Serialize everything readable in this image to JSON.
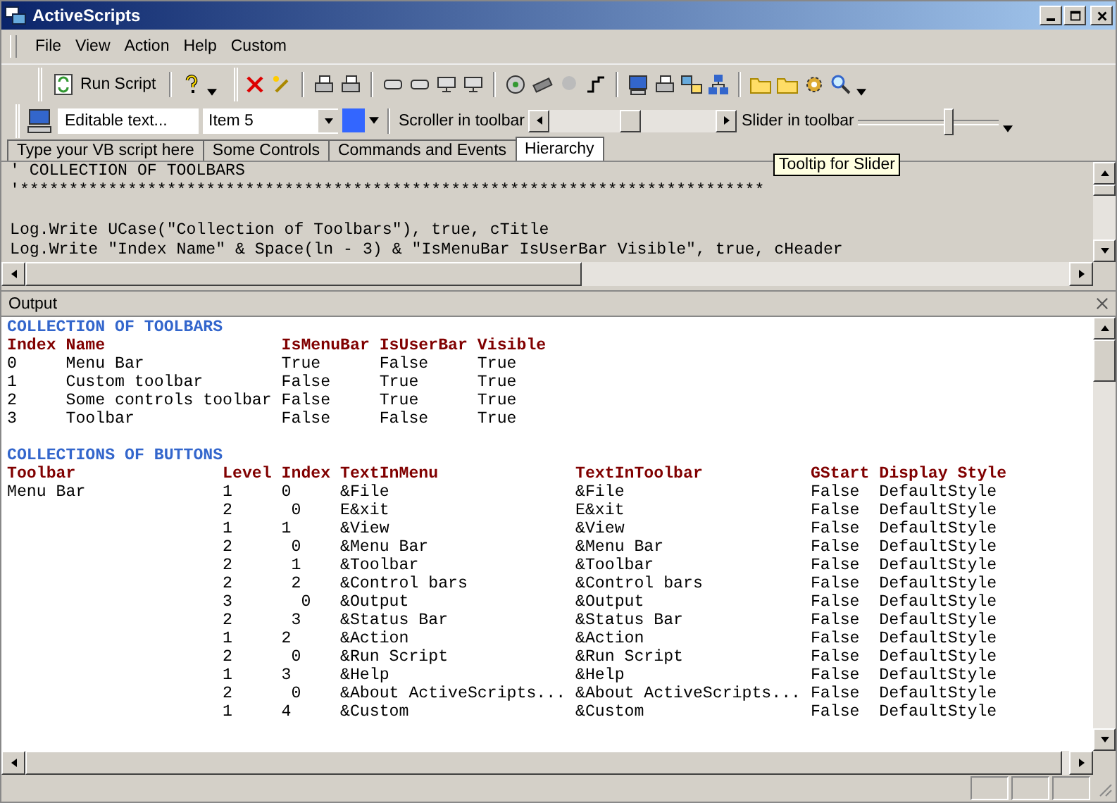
{
  "window": {
    "title": "ActiveScripts"
  },
  "menu": [
    "File",
    "View",
    "Action",
    "Help",
    "Custom"
  ],
  "toolbar": {
    "run_button": "Run Script"
  },
  "controls_bar": {
    "text_field": "Editable text...",
    "combo": "Item 5",
    "color": "#3366ff",
    "scroller_label": "Scroller in toolbar",
    "slider_label": "Slider in toolbar",
    "slider": {
      "level": 0.64
    }
  },
  "tabs": [
    {
      "label": "Type your VB script here",
      "selected": false
    },
    {
      "label": "Some Controls",
      "selected": false
    },
    {
      "label": "Commands and Events",
      "selected": false
    },
    {
      "label": "Hierarchy",
      "selected": true
    }
  ],
  "tooltip": "Tooltip for Slider",
  "script_blocks": [
    [
      "' COLLECTION OF TOOLBARS",
      "'****************************************************************************"
    ],
    [
      "Log.Write UCase(\"Collection of Toolbars\"), true, cTitle",
      "Log.Write \"Index Name\" & Space(ln - 3) & \"IsMenuBar IsUserBar Visible\", true, cHeader"
    ]
  ],
  "output": {
    "title": "Output",
    "sections": [
      {
        "title": "COLLECTION OF TOOLBARS",
        "columns": [
          "Index",
          "Name",
          "IsMenuBar",
          "IsUserBar",
          "Visible"
        ],
        "rows": [
          [
            "0",
            "Menu Bar",
            "True",
            "False",
            "True"
          ],
          [
            "1",
            "Custom toolbar",
            "False",
            "True",
            "True"
          ],
          [
            "2",
            "Some controls toolbar",
            "False",
            "True",
            "True"
          ],
          [
            "3",
            "Toolbar",
            "False",
            "False",
            "True"
          ]
        ]
      },
      {
        "title": "COLLECTIONS OF BUTTONS",
        "columns": [
          "Toolbar",
          "Level",
          "Index",
          "TextInMenu",
          "TextInToolbar",
          "GStart",
          "Display Style"
        ],
        "rows": [
          [
            "Menu Bar",
            "1",
            "0",
            "&File",
            "&File",
            "False",
            "DefaultStyle"
          ],
          [
            "",
            "2",
            " 0",
            "E&xit",
            "E&xit",
            "False",
            "DefaultStyle"
          ],
          [
            "",
            "1",
            "1",
            "&View",
            "&View",
            "False",
            "DefaultStyle"
          ],
          [
            "",
            "2",
            " 0",
            "&Menu Bar",
            "&Menu Bar",
            "False",
            "DefaultStyle"
          ],
          [
            "",
            "2",
            " 1",
            "&Toolbar",
            "&Toolbar",
            "False",
            "DefaultStyle"
          ],
          [
            "",
            "2",
            " 2",
            "&Control bars",
            "&Control bars",
            "False",
            "DefaultStyle"
          ],
          [
            "",
            "3",
            "  0",
            "&Output",
            "&Output",
            "False",
            "DefaultStyle"
          ],
          [
            "",
            "2",
            " 3",
            "&Status Bar",
            "&Status Bar",
            "False",
            "DefaultStyle"
          ],
          [
            "",
            "1",
            "2",
            "&Action",
            "&Action",
            "False",
            "DefaultStyle"
          ],
          [
            "",
            "2",
            " 0",
            "&Run Script",
            "&Run Script",
            "False",
            "DefaultStyle"
          ],
          [
            "",
            "1",
            "3",
            "&Help",
            "&Help",
            "False",
            "DefaultStyle"
          ],
          [
            "",
            "2",
            " 0",
            "&About ActiveScripts...",
            "&About ActiveScripts...",
            "False",
            "DefaultStyle"
          ],
          [
            "",
            "1",
            "4",
            "&Custom",
            "&Custom",
            "False",
            "DefaultStyle"
          ]
        ]
      }
    ]
  }
}
